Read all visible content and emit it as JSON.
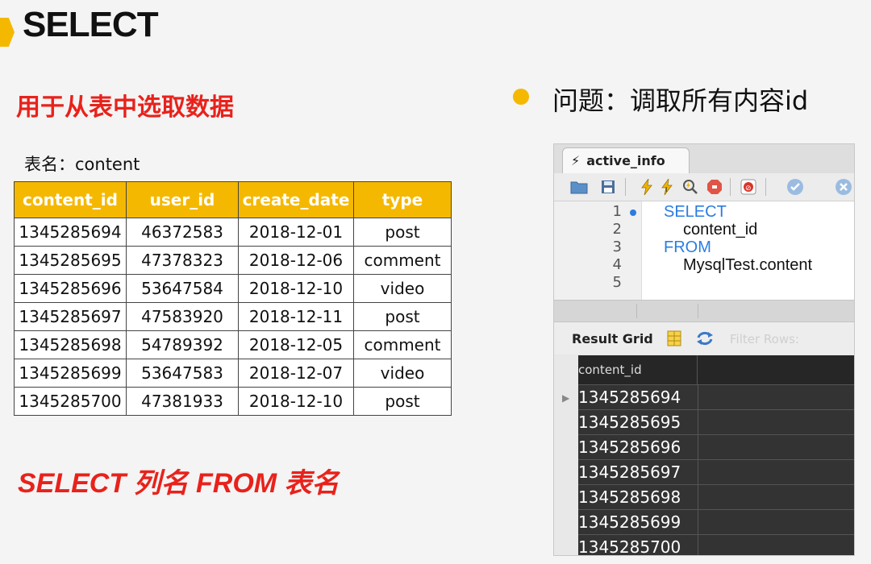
{
  "slide": {
    "title": "SELECT",
    "subtitle": "用于从表中选取数据",
    "table_caption": "表名：content",
    "syntax": "SELECT 列名 FROM 表名",
    "question": "问题：调取所有内容id"
  },
  "table": {
    "headers": [
      "content_id",
      "user_id",
      "create_date",
      "type"
    ],
    "rows": [
      [
        "1345285694",
        "46372583",
        "2018-12-01",
        "post"
      ],
      [
        "1345285695",
        "47378323",
        "2018-12-06",
        "comment"
      ],
      [
        "1345285696",
        "53647584",
        "2018-12-10",
        "video"
      ],
      [
        "1345285697",
        "47583920",
        "2018-12-11",
        "post"
      ],
      [
        "1345285698",
        "54789392",
        "2018-12-05",
        "comment"
      ],
      [
        "1345285699",
        "53647583",
        "2018-12-07",
        "video"
      ],
      [
        "1345285700",
        "47381933",
        "2018-12-10",
        "post"
      ]
    ]
  },
  "workbench": {
    "tab_label": "active_info",
    "line_numbers": [
      "1",
      "2",
      "3",
      "4",
      "5"
    ],
    "code": {
      "line1": "SELECT",
      "line2": "content_id",
      "line3": "FROM",
      "line4": "MysqlTest.content"
    },
    "result_grid_label": "Result Grid",
    "filter_label": "Filter Rows:",
    "column_header": "content_id",
    "results": [
      "1345285694",
      "1345285695",
      "1345285696",
      "1345285697",
      "1345285698",
      "1345285699",
      "1345285700"
    ]
  },
  "colors": {
    "accent": "#f5b800",
    "red": "#e8221b",
    "keyword_blue": "#2a7de1"
  },
  "icons": [
    "bolt-icon",
    "folder-icon",
    "save-icon",
    "execute-icon",
    "execute-current-icon",
    "explain-icon",
    "stop-icon",
    "toggle-icon",
    "commit-icon",
    "rollback-icon",
    "grid-view-icon",
    "refresh-icon"
  ]
}
